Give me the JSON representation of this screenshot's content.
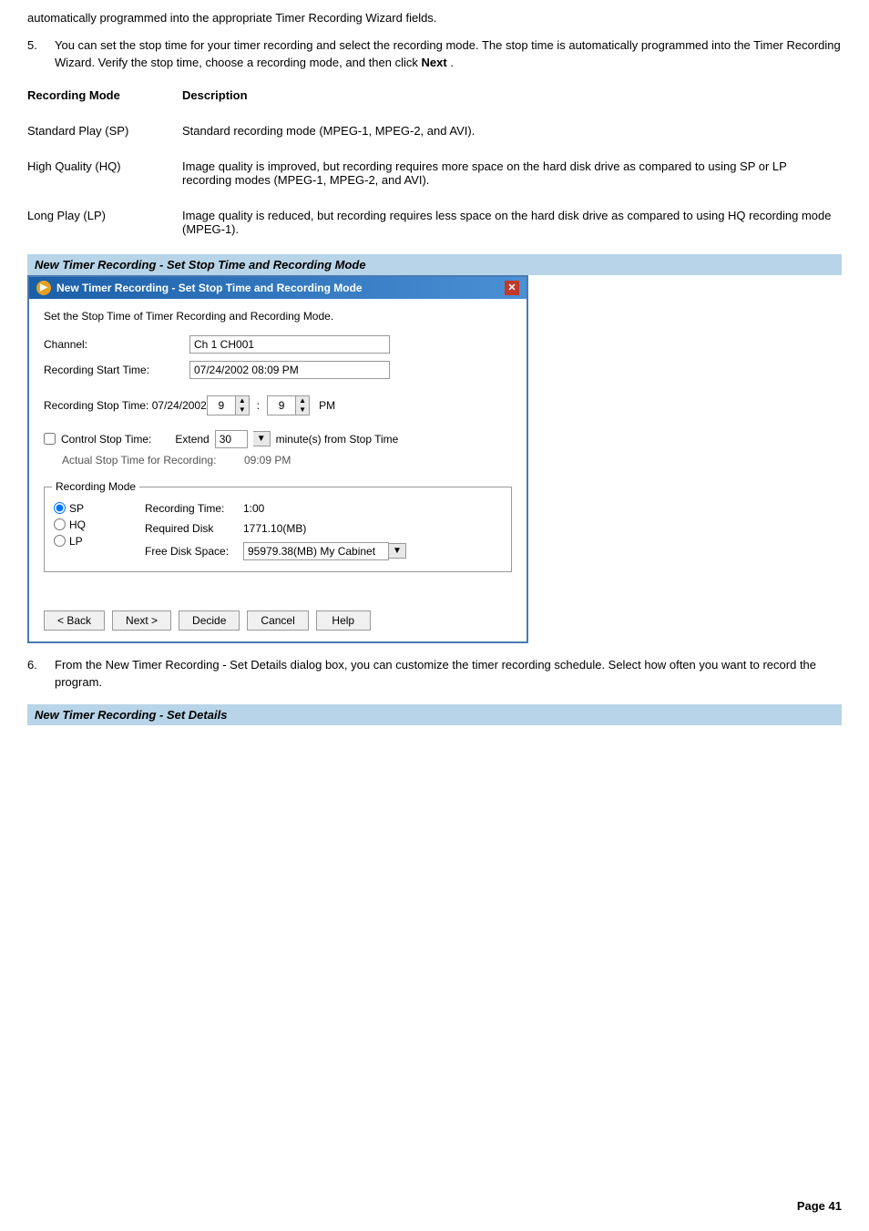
{
  "intro": {
    "text": "automatically programmed into the appropriate Timer Recording Wizard fields."
  },
  "step5": {
    "number": "5.",
    "text_before": "You can set the stop time for your timer recording and select the recording mode. The stop time is automatically programmed into the Timer Recording Wizard. Verify the stop time, choose a recording mode, and then click ",
    "bold_word": "Next",
    "text_after": " ."
  },
  "table": {
    "col1_header": "Recording Mode",
    "col2_header": "Description",
    "rows": [
      {
        "mode": "Standard Play (SP)",
        "description": "Standard recording mode (MPEG-1, MPEG-2, and AVI)."
      },
      {
        "mode": "High Quality (HQ)",
        "description": "Image quality is improved, but recording requires more space on the hard disk drive as compared to using SP or LP recording modes (MPEG-1, MPEG-2, and AVI)."
      },
      {
        "mode": "Long Play (LP)",
        "description": "Image quality is reduced, but recording requires less space on the hard disk drive as compared to using HQ recording mode (MPEG-1)."
      }
    ]
  },
  "section_banner1": {
    "text": "New Timer Recording - Set Stop Time and Recording Mode"
  },
  "dialog": {
    "title": "New Timer Recording - Set Stop Time and Recording Mode",
    "subtitle": "Set the Stop Time of Timer Recording and Recording Mode.",
    "channel_label": "Channel:",
    "channel_value": "Ch 1 CH001",
    "start_time_label": "Recording Start Time:",
    "start_time_value": "07/24/2002 08:09 PM",
    "stop_time_label": "Recording Stop Time: 07/24/2002",
    "stop_hour": "9",
    "stop_minute": "9",
    "stop_ampm": "PM",
    "control_stop_label": "Control Stop Time:",
    "extend_label": "Extend",
    "extend_value": "30",
    "extend_suffix": "minute(s) from Stop Time",
    "actual_stop_label": "Actual Stop Time for Recording:",
    "actual_stop_value": "09:09 PM",
    "recording_mode_legend": "Recording Mode",
    "modes": [
      "SP",
      "HQ",
      "LP"
    ],
    "selected_mode": "SP",
    "recording_time_label": "Recording Time:",
    "recording_time_value": "1:00",
    "required_disk_label": "Required Disk",
    "required_disk_value": "1771.10(MB)",
    "free_disk_label": "Free Disk Space:",
    "free_disk_value": "95979.38(MB) My Cabinet",
    "btn_back": "< Back",
    "btn_next": "Next >",
    "btn_decide": "Decide",
    "btn_cancel": "Cancel",
    "btn_help": "Help"
  },
  "step6": {
    "number": "6.",
    "text": "From the New Timer Recording - Set Details dialog box, you can customize the timer recording schedule. Select how often you want to record the program."
  },
  "section_banner2": {
    "text": "New Timer Recording - Set Details"
  },
  "page_number": "Page 41"
}
